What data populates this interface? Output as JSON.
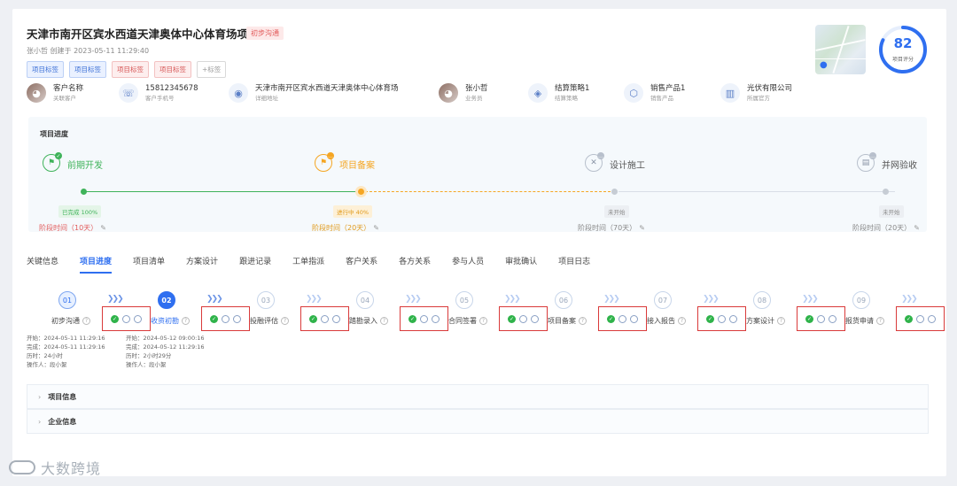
{
  "project": {
    "title": "天津市南开区宾水西道天津奥体中心体育场项目",
    "status_tag": "初步沟通",
    "creator": "张小哲",
    "created_label": "创建于",
    "created_time": "2023-05-11 11:29:40",
    "tags": [
      {
        "label": "项目标签",
        "color": "blue"
      },
      {
        "label": "项目标签",
        "color": "blue"
      },
      {
        "label": "项目标签",
        "color": "red"
      },
      {
        "label": "项目标签",
        "color": "red"
      },
      {
        "label": "+标签",
        "color": "add"
      }
    ],
    "score": 82,
    "score_label": "项目评分",
    "score_max": 100
  },
  "info": [
    {
      "value": "客户名称",
      "label": "关联客户",
      "icon": "customer-avatar"
    },
    {
      "value": "15812345678",
      "label": "客户手机号",
      "icon": "phone-icon"
    },
    {
      "value": "天津市南开区宾水西道天津奥体中心体育场",
      "label": "详细地址",
      "icon": "location-icon"
    },
    {
      "value": "张小哲",
      "label": "业务员",
      "icon": "salesperson-avatar"
    },
    {
      "value": "结算策略1",
      "label": "结算策略",
      "icon": "strategy-icon"
    },
    {
      "value": "销售产品1",
      "label": "销售产品",
      "icon": "product-icon"
    },
    {
      "value": "光伏有限公司",
      "label": "所属官方",
      "icon": "company-icon"
    }
  ],
  "progress": {
    "title": "项目进度",
    "stages": [
      {
        "name": "前期开发",
        "state": "done",
        "status": "已完成 100%",
        "time": "阶段时间（10天）"
      },
      {
        "name": "项目备案",
        "state": "active",
        "status": "进行中 40%",
        "time": "阶段时间（20天）"
      },
      {
        "name": "设计施工",
        "state": "pending",
        "status": "未开始",
        "time": "阶段时间（70天）"
      },
      {
        "name": "并网验收",
        "state": "pending",
        "status": "未开始",
        "time": "阶段时间（20天）"
      }
    ]
  },
  "tabs": [
    "关键信息",
    "项目进度",
    "项目清单",
    "方案设计",
    "跟进记录",
    "工单指派",
    "客户关系",
    "各方关系",
    "参与人员",
    "审批确认",
    "项目日志"
  ],
  "active_tab": "项目进度",
  "steps": [
    {
      "num": "01",
      "label": "初步沟通",
      "state": "done"
    },
    {
      "num": "02",
      "label": "收资初勘",
      "state": "current"
    },
    {
      "num": "03",
      "label": "投融评估",
      "state": "pending"
    },
    {
      "num": "04",
      "label": "踏勘录入",
      "state": "pending"
    },
    {
      "num": "05",
      "label": "合同签署",
      "state": "pending"
    },
    {
      "num": "06",
      "label": "项目备案",
      "state": "pending"
    },
    {
      "num": "07",
      "label": "接入报告",
      "state": "pending"
    },
    {
      "num": "08",
      "label": "方案设计",
      "state": "pending"
    },
    {
      "num": "09",
      "label": "报货申请",
      "state": "pending"
    }
  ],
  "step_logs": [
    {
      "start": "开始：2024-05-11 11:29:16",
      "finish": "完成：2024-05-11 11:29:16",
      "duration": "历时：24小时",
      "operator": "操作人：段小絮"
    },
    {
      "start": "开始：2024-05-12 09:00:16",
      "finish": "完成：2024-05-12 11:29:16",
      "duration": "历时：2小时29分",
      "operator": "操作人：段小絮"
    }
  ],
  "sections": [
    "项目信息",
    "企业信息"
  ],
  "watermark": "大数跨境",
  "colors": {
    "accent": "#2f6ff0",
    "done": "#3fb35a",
    "active": "#f5a623",
    "highlight_box": "#d93a3a"
  }
}
